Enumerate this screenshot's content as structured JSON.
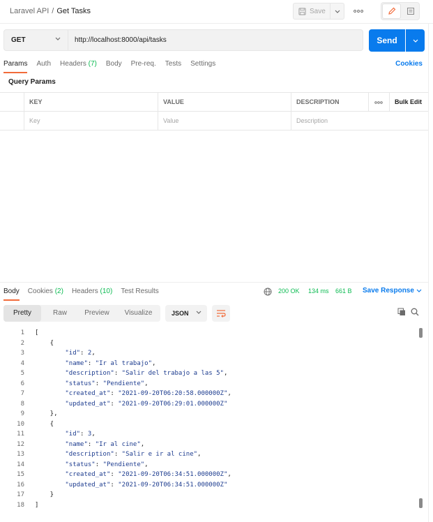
{
  "header": {
    "breadcrumb_collection": "Laravel API",
    "breadcrumb_separator": "/",
    "breadcrumb_request": "Get Tasks",
    "save_label": "Save"
  },
  "request": {
    "method": "GET",
    "url": "http://localhost:8000/api/tasks",
    "send_label": "Send"
  },
  "request_tabs": [
    {
      "label": "Params",
      "count": "",
      "active": true
    },
    {
      "label": "Auth",
      "count": "",
      "active": false
    },
    {
      "label": "Headers ",
      "count": "(7)",
      "active": false
    },
    {
      "label": "Body",
      "count": "",
      "active": false
    },
    {
      "label": "Pre-req.",
      "count": "",
      "active": false
    },
    {
      "label": "Tests",
      "count": "",
      "active": false
    },
    {
      "label": "Settings",
      "count": "",
      "active": false
    }
  ],
  "cookies_label": "Cookies",
  "query_params": {
    "title": "Query Params",
    "columns": {
      "key": "KEY",
      "value": "VALUE",
      "description": "DESCRIPTION",
      "bulk_edit": "Bulk Edit"
    },
    "placeholders": {
      "key": "Key",
      "value": "Value",
      "description": "Description"
    }
  },
  "response_tabs": [
    {
      "label": "Body",
      "count": "",
      "active": true
    },
    {
      "label": "Cookies ",
      "count": "(2)",
      "active": false
    },
    {
      "label": "Headers ",
      "count": "(10)",
      "active": false
    },
    {
      "label": "Test Results",
      "count": "",
      "active": false
    }
  ],
  "response_status": {
    "status": "200 OK",
    "time": "134 ms",
    "size": "661 B",
    "save_label": "Save Response"
  },
  "body_view": {
    "modes": [
      "Pretty",
      "Raw",
      "Preview",
      "Visualize"
    ],
    "active_mode": "Pretty",
    "format": "JSON"
  },
  "code_lines": [
    {
      "n": "1",
      "t": "["
    },
    {
      "n": "2",
      "t": "    {"
    },
    {
      "n": "3",
      "t": "        \"id\": 2,"
    },
    {
      "n": "4",
      "t": "        \"name\": \"Ir al trabajo\","
    },
    {
      "n": "5",
      "t": "        \"description\": \"Salir del trabajo a las 5\","
    },
    {
      "n": "6",
      "t": "        \"status\": \"Pendiente\","
    },
    {
      "n": "7",
      "t": "        \"created_at\": \"2021-09-20T06:20:58.000000Z\","
    },
    {
      "n": "8",
      "t": "        \"updated_at\": \"2021-09-20T06:29:01.000000Z\""
    },
    {
      "n": "9",
      "t": "    },"
    },
    {
      "n": "10",
      "t": "    {"
    },
    {
      "n": "11",
      "t": "        \"id\": 3,"
    },
    {
      "n": "12",
      "t": "        \"name\": \"Ir al cine\","
    },
    {
      "n": "13",
      "t": "        \"description\": \"Salir e ir al cine\","
    },
    {
      "n": "14",
      "t": "        \"status\": \"Pendiente\","
    },
    {
      "n": "15",
      "t": "        \"created_at\": \"2021-09-20T06:34:51.000000Z\","
    },
    {
      "n": "16",
      "t": "        \"updated_at\": \"2021-09-20T06:34:51.000000Z\""
    },
    {
      "n": "17",
      "t": "    }"
    },
    {
      "n": "18",
      "t": "]"
    }
  ],
  "colors": {
    "accent": "#097bed",
    "tab_indicator": "#f26b3a",
    "success": "#0cbb52"
  }
}
